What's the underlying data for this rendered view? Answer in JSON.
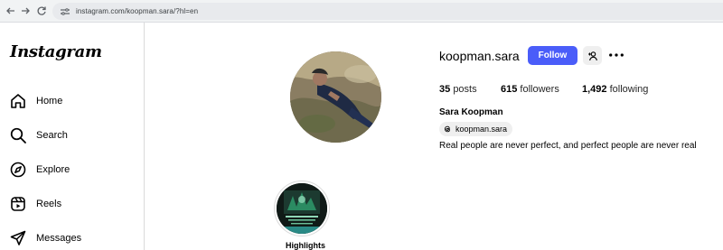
{
  "browser": {
    "url": "instagram.com/koopman.sara/?hl=en"
  },
  "sidebar": {
    "logo": "Instagram",
    "items": [
      {
        "label": "Home",
        "icon": "home-icon"
      },
      {
        "label": "Search",
        "icon": "search-icon"
      },
      {
        "label": "Explore",
        "icon": "explore-icon"
      },
      {
        "label": "Reels",
        "icon": "reels-icon"
      },
      {
        "label": "Messages",
        "icon": "messages-icon"
      }
    ]
  },
  "profile": {
    "username": "koopman.sara",
    "follow_label": "Follow",
    "posts_count": "35",
    "posts_label": "posts",
    "followers_count": "615",
    "followers_label": "followers",
    "following_count": "1,492",
    "following_label": "following",
    "full_name": "Sara Koopman",
    "threads_handle": "koopman.sara",
    "bio": "Real people are never perfect, and perfect people are never real"
  },
  "highlights": [
    {
      "label": "Highlights"
    }
  ],
  "colors": {
    "follow_button": "#4a5df9",
    "secondary_button": "#efefef",
    "divider": "#dbdbdb"
  }
}
